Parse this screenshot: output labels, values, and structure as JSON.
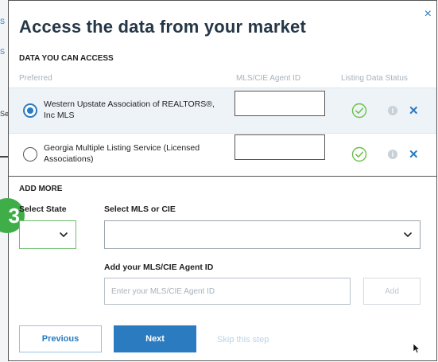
{
  "background": {
    "fragments": [
      "S",
      "S",
      "Se"
    ]
  },
  "modal": {
    "title": "Access the data from your market",
    "close_label": "×"
  },
  "data_access": {
    "section_label": "DATA YOU CAN ACCESS",
    "columns": {
      "preferred": "Preferred",
      "agent_id": "MLS/CIE Agent ID",
      "status": "Listing Data Status"
    },
    "rows": [
      {
        "name": "Western Upstate Association of REALTORS®, Inc MLS",
        "selected": true,
        "agent_id": "",
        "status": "active"
      },
      {
        "name": "Georgia Multiple Listing Service (Licensed Associations)",
        "selected": false,
        "agent_id": "",
        "status": "active"
      }
    ],
    "info_glyph": "i",
    "remove_glyph": "✕"
  },
  "add_more": {
    "section_label": "ADD MORE",
    "step_badge": "3",
    "state_label": "Select State",
    "state_value": "",
    "mls_label": "Select MLS or CIE",
    "mls_value": "",
    "agent_label": "Add your MLS/CIE Agent ID",
    "agent_placeholder": "Enter your MLS/CIE Agent ID",
    "agent_value": "",
    "add_label": "Add"
  },
  "footer": {
    "previous_label": "Previous",
    "next_label": "Next",
    "skip_label": "Skip this step"
  },
  "colors": {
    "accent": "#2a7bc0",
    "success": "#3fae49",
    "title": "#253746",
    "row_highlight": "#eef3f8"
  }
}
